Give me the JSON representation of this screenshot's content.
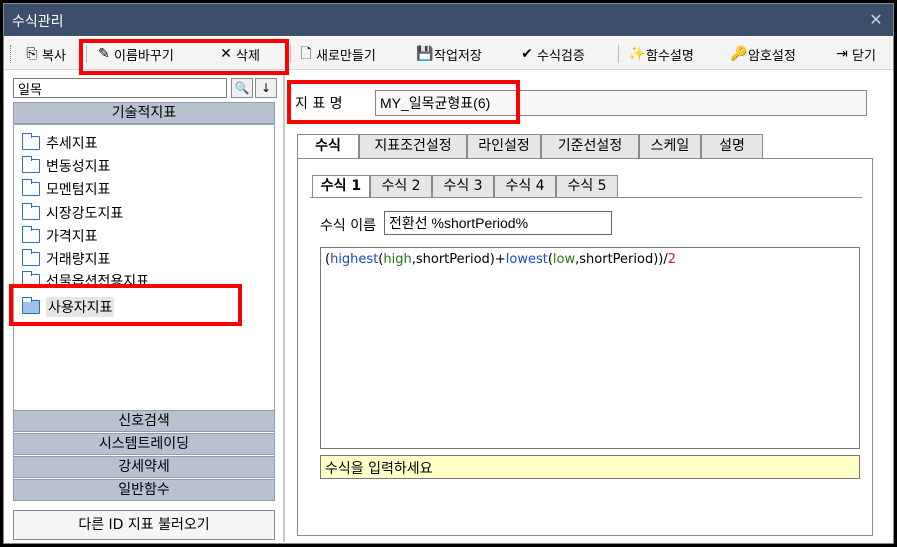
{
  "window": {
    "title": "수식관리",
    "close_glyph": "✕"
  },
  "toolbar": {
    "copy": "복사",
    "rename": "이름바꾸기",
    "delete": "삭제",
    "new": "새로만들기",
    "save": "작업저장",
    "verify": "수식검증",
    "function_desc": "함수설명",
    "password": "암호설정",
    "close": "닫기"
  },
  "left": {
    "search_value": "일목",
    "search_btn": "🔍",
    "down_btn": "↓",
    "header": "기술적지표",
    "tree": [
      {
        "label": "추세지표"
      },
      {
        "label": "변동성지표"
      },
      {
        "label": "모멘텀지표"
      },
      {
        "label": "시장강도지표"
      },
      {
        "label": "가격지표"
      },
      {
        "label": "거래량지표"
      },
      {
        "label": "선물옵션전용지표"
      },
      {
        "label": "사용자지표"
      }
    ],
    "sections": [
      "신호검색",
      "시스템트레이딩",
      "강세약세",
      "일반함수"
    ],
    "import_button": "다른 ID 지표 불러오기"
  },
  "right": {
    "name_label": "지 표 명",
    "name_value": "MY_일목균형표(6)",
    "tabs": [
      "수식",
      "지표조건설정",
      "라인설정",
      "기준선설정",
      "스케일",
      "설명"
    ],
    "subtabs": [
      "수식 1",
      "수식 2",
      "수식 3",
      "수식 4",
      "수식 5"
    ],
    "formula_name_label": "수식 이름",
    "formula_name_value": "전환선 %shortPeriod%",
    "formula": {
      "p1": "(",
      "f1": "highest",
      "p2": "(",
      "v1": "high",
      "p3": ",shortPeriod)+",
      "f2": "lowest",
      "p4": "(",
      "v2": "low",
      "p5": ",shortPeriod))/",
      "n1": "2"
    },
    "hint": "수식을 입력하세요"
  }
}
